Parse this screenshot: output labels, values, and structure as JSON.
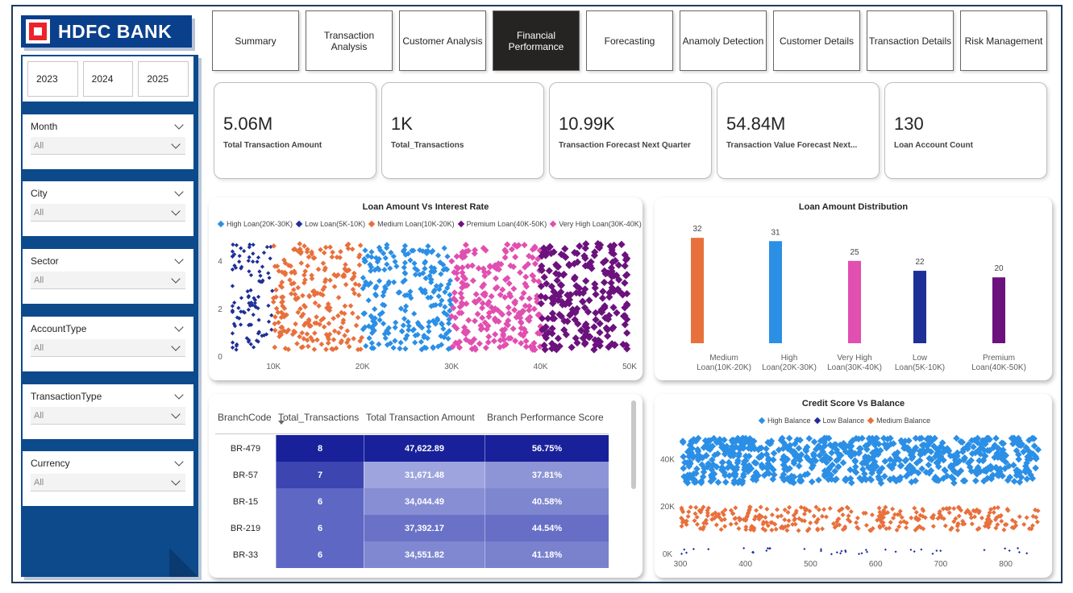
{
  "brand": {
    "name": "HDFC BANK"
  },
  "years": [
    "2023",
    "2024",
    "2025"
  ],
  "slicers": [
    {
      "title": "Month",
      "value": "All"
    },
    {
      "title": "City",
      "value": "All"
    },
    {
      "title": "Sector",
      "value": "All"
    },
    {
      "title": "AccountType",
      "value": "All"
    },
    {
      "title": "TransactionType",
      "value": "All"
    },
    {
      "title": "Currency",
      "value": "All"
    }
  ],
  "tabs": [
    "Summary",
    "Transaction Analysis",
    "Customer Analysis",
    "Financial Performance",
    "Forecasting",
    "Anamoly Detection",
    "Customer Details",
    "Transaction Details",
    "Risk Management"
  ],
  "active_tab": "Financial Performance",
  "kpis": [
    {
      "value": "5.06M",
      "label": "Total Transaction Amount"
    },
    {
      "value": "1K",
      "label": "Total_Transactions"
    },
    {
      "value": "10.99K",
      "label": "Transaction Forecast Next Quarter"
    },
    {
      "value": "54.84M",
      "label": "Transaction Value Forecast Next..."
    },
    {
      "value": "130",
      "label": "Loan Account Count"
    }
  ],
  "colors": {
    "high": "#2b8fe6",
    "low": "#1e2f98",
    "medium": "#e8703c",
    "premium": "#6b127d",
    "very_high": "#e14fb0",
    "balance_high": "#2b8fe6",
    "balance_low": "#1e2f98",
    "balance_medium": "#e8703c",
    "brand_blue": "#0d4a8c",
    "brand_red": "#ed232a"
  },
  "chart_data": [
    {
      "type": "scatter",
      "title": "Loan Amount Vs Interest Rate",
      "legend": [
        "High Loan(20K-30K)",
        "Low Loan(5K-10K)",
        "Medium Loan(10K-20K)",
        "Premium Loan(40K-50K)",
        "Very High Loan(30K-40K)"
      ],
      "x_ticks": [
        "10K",
        "20K",
        "30K",
        "40K",
        "50K"
      ],
      "y_ticks": [
        "0",
        "2",
        "4"
      ],
      "xlim": [
        5000,
        50000
      ],
      "ylim": [
        0,
        5
      ],
      "series": [
        {
          "name": "Low Loan(5K-10K)",
          "x_range": [
            5000,
            10000
          ],
          "y_range": [
            0,
            5
          ]
        },
        {
          "name": "Medium Loan(10K-20K)",
          "x_range": [
            10000,
            20000
          ],
          "y_range": [
            0,
            5
          ]
        },
        {
          "name": "High Loan(20K-30K)",
          "x_range": [
            20000,
            30000
          ],
          "y_range": [
            0,
            5
          ]
        },
        {
          "name": "Very High Loan(30K-40K)",
          "x_range": [
            30000,
            40000
          ],
          "y_range": [
            0,
            5
          ]
        },
        {
          "name": "Premium Loan(40K-50K)",
          "x_range": [
            40000,
            50000
          ],
          "y_range": [
            0,
            5
          ]
        }
      ],
      "legend_position": "top"
    },
    {
      "type": "bar",
      "title": "Loan Amount Distribution",
      "categories": [
        "Medium Loan(10K-20K)",
        "High Loan(20K-30K)",
        "Very High Loan(30K-40K)",
        "Low Loan(5K-10K)",
        "Premium Loan(40K-50K)"
      ],
      "category_lines": [
        [
          "Medium",
          "Loan(10K-20K)"
        ],
        [
          "High",
          "Loan(20K-30K)"
        ],
        [
          "Very High",
          "Loan(30K-40K)"
        ],
        [
          "Low",
          "Loan(5K-10K)"
        ],
        [
          "Premium",
          "Loan(40K-50K)"
        ]
      ],
      "values": [
        32,
        31,
        25,
        22,
        20
      ],
      "ylim": [
        0,
        35
      ]
    },
    {
      "type": "scatter",
      "title": "Credit Score Vs Balance",
      "legend": [
        "High Balance",
        "Low Balance",
        "Medium Balance"
      ],
      "x_ticks": [
        "300",
        "400",
        "500",
        "600",
        "700",
        "800"
      ],
      "y_ticks": [
        "0K",
        "20K",
        "40K"
      ],
      "xlim": [
        300,
        850
      ],
      "ylim": [
        0,
        50000
      ],
      "series": [
        {
          "name": "High Balance",
          "y_range": [
            30000,
            50000
          ]
        },
        {
          "name": "Medium Balance",
          "y_range": [
            10000,
            20000
          ]
        },
        {
          "name": "Low Balance",
          "y_range": [
            0,
            3000
          ]
        }
      ],
      "legend_position": "top"
    },
    {
      "type": "table",
      "columns": [
        "BranchCode",
        "Total_Transactions",
        "Total Transaction Amount",
        "Branch Performance Score"
      ],
      "rows": [
        [
          "BR-479",
          "8",
          "47,622.89",
          "56.75%"
        ],
        [
          "BR-57",
          "7",
          "31,671.48",
          "37.81%"
        ],
        [
          "BR-15",
          "6",
          "34,044.49",
          "40.58%"
        ],
        [
          "BR-219",
          "6",
          "37,392.17",
          "44.54%"
        ],
        [
          "BR-33",
          "6",
          "34,551.82",
          "41.18%"
        ]
      ],
      "sort_column": "Total_Transactions"
    }
  ]
}
